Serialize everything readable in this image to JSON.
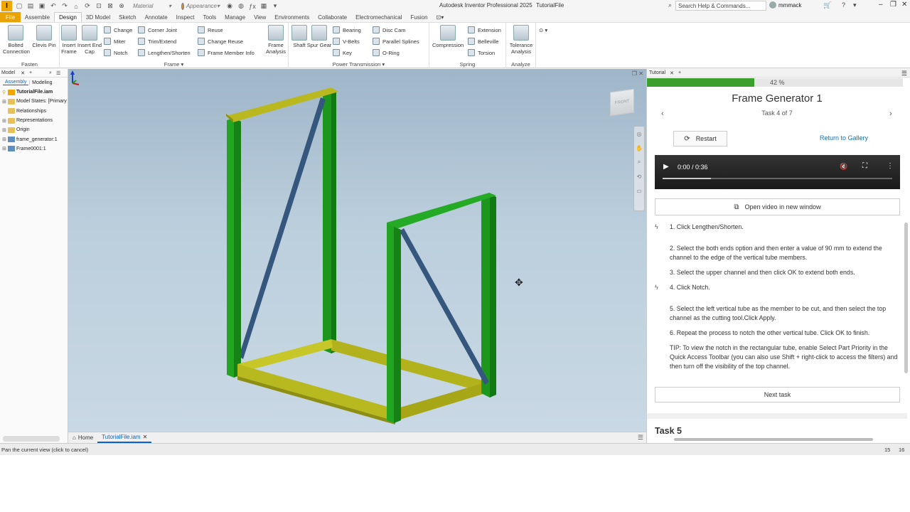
{
  "titlebar": {
    "app_title": "Autodesk Inventor Professional 2025",
    "file_name": "TutorialFile",
    "material_placeholder": "Material",
    "appearance_placeholder": "Appearance",
    "search_placeholder": "Search Help & Commands...",
    "user": "mmmack"
  },
  "ribbon_tabs": [
    "File",
    "Assemble",
    "Design",
    "3D Model",
    "Sketch",
    "Annotate",
    "Inspect",
    "Tools",
    "Manage",
    "View",
    "Environments",
    "Collaborate",
    "Electromechanical",
    "Fusion"
  ],
  "ribbon": {
    "fasten": {
      "label": "Fasten",
      "bolted": "Bolted Connection",
      "clevis": "Clevis Pin"
    },
    "frame": {
      "label": "Frame",
      "insert_frame": "Insert Frame",
      "insert_end_cap": "Insert End Cap",
      "change": "Change",
      "miter": "Miter",
      "notch": "Notch",
      "corner_joint": "Corner Joint",
      "trim_extend": "Trim/Extend",
      "lengthen_shorten": "Lengthen/Shorten",
      "reuse": "Reuse",
      "change_reuse": "Change Reuse",
      "frame_member_info": "Frame Member Info",
      "frame_analysis": "Frame Analysis"
    },
    "power": {
      "label": "Power Transmission",
      "shaft": "Shaft",
      "spur_gear": "Spur Gear",
      "bearing": "Bearing",
      "vbelts": "V-Belts",
      "key": "Key",
      "disc_cam": "Disc Cam",
      "parallel_splines": "Parallel Splines",
      "oring": "O-Ring"
    },
    "spring": {
      "label": "Spring",
      "compression": "Compression",
      "extension": "Extension",
      "belleville": "Belleville",
      "torsion": "Torsion"
    },
    "analyze": {
      "label": "Analyze",
      "tolerance": "Tolerance Analysis"
    }
  },
  "browser": {
    "title": "Model",
    "tabs": [
      "Assembly",
      "Modeling"
    ],
    "items": [
      {
        "label": "TutorialFile.iam",
        "type": "asm"
      },
      {
        "label": "Model States: [Primary",
        "type": "folder"
      },
      {
        "label": "Relationships",
        "type": "folder"
      },
      {
        "label": "Representations",
        "type": "folder"
      },
      {
        "label": "Origin",
        "type": "folder"
      },
      {
        "label": "frame_generator:1",
        "type": "part"
      },
      {
        "label": "Frame0001:1",
        "type": "part"
      }
    ]
  },
  "doc_tabs": {
    "home": "Home",
    "file": "TutorialFile.iam"
  },
  "status": {
    "text": "Pan the current view (click to cancel)",
    "num1": "15",
    "num2": "16"
  },
  "tutorial": {
    "tab": "Tutorial",
    "progress_label": "42 %",
    "progress_value": 0.42,
    "title": "Frame Generator 1",
    "subtitle": "Task 4 of 7",
    "restart": "Restart",
    "gallery": "Return to Gallery",
    "video_time": "0:00 / 0:36",
    "open_video": "Open video in new window",
    "steps": [
      {
        "text": "1. Click Lengthen/Shorten.",
        "bolt": true
      },
      {
        "text": "2. Select the both ends option and then enter a value of 90 mm to extend the channel to the edge of the vertical tube members.",
        "bolt": false
      },
      {
        "text": "3. Select the upper channel and then click OK to extend both ends.",
        "bolt": false
      },
      {
        "text": "4. Click Notch.",
        "bolt": true
      },
      {
        "text": "5. Select the left vertical tube as the member to be cut, and then select the top channel as the cutting tool.Click Apply.",
        "bolt": false
      },
      {
        "text": "6. Repeat the process to notch the other vertical tube. Click OK to finish.",
        "bolt": false
      },
      {
        "text": "TIP: To view the notch in the rectangular tube, enable Select Part Priority in the Quick Access Toolbar (you can also use Shift + right-click to access the filters) and then turn off the visibility of the top channel.",
        "bolt": false
      }
    ],
    "next_task": "Next task",
    "next_heading": "Task 5"
  },
  "colors": {
    "accent": "#0a64c8",
    "progress": "#3ca02c",
    "tube": "#1fa31f",
    "channel": "#b6b61e",
    "brace": "#33547a",
    "file_tab": "#e8a300"
  }
}
